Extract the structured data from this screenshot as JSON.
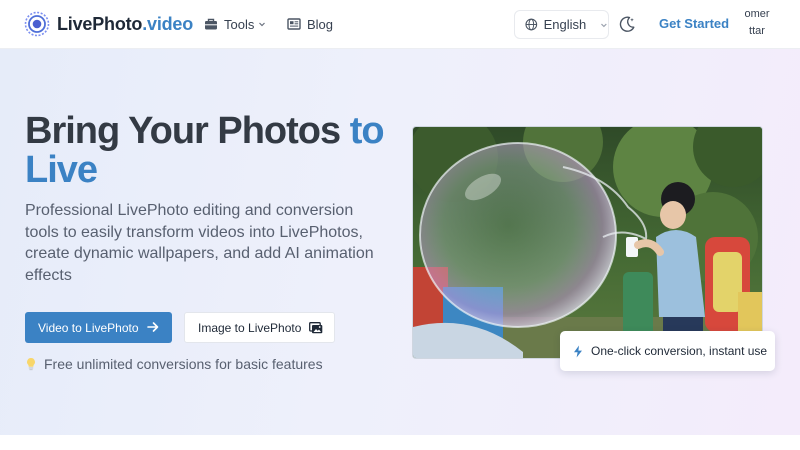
{
  "header": {
    "logo": {
      "name": "LivePhoto",
      "domain": ".video",
      "icon": "logo-ring-icon"
    },
    "nav": [
      {
        "label": "Tools",
        "icon": "toolbox-icon",
        "has_dropdown": true
      },
      {
        "label": "Blog",
        "icon": "newspaper-icon",
        "has_dropdown": false
      }
    ],
    "language": {
      "label": "English",
      "icon": "globe-icon"
    },
    "theme_toggle_icon": "moon-icon",
    "cta_label": "Get Started",
    "avatar_lines": [
      "omer",
      "ttar"
    ]
  },
  "hero": {
    "title_main": "Bring Your Photos ",
    "title_accent_1": "to",
    "title_accent_2": "Live",
    "description": "Professional LivePhoto editing and conversion tools to easily transform videos into LivePhotos, create dynamic wallpapers, and add AI animation effects",
    "primary_button": {
      "label": "Video to LivePhoto",
      "icon": "arrow-right-icon"
    },
    "secondary_button": {
      "label": "Image to LivePhoto",
      "icon": "images-icon"
    },
    "note": {
      "icon": "lightbulb-icon",
      "text": "Free unlimited conversions for basic features"
    }
  },
  "media": {
    "feature_badge": {
      "icon": "bolt-icon",
      "text": "One-click conversion, instant use"
    }
  },
  "colors": {
    "accent": "#3b82c4",
    "title": "#333a44",
    "body_text": "#586070"
  }
}
